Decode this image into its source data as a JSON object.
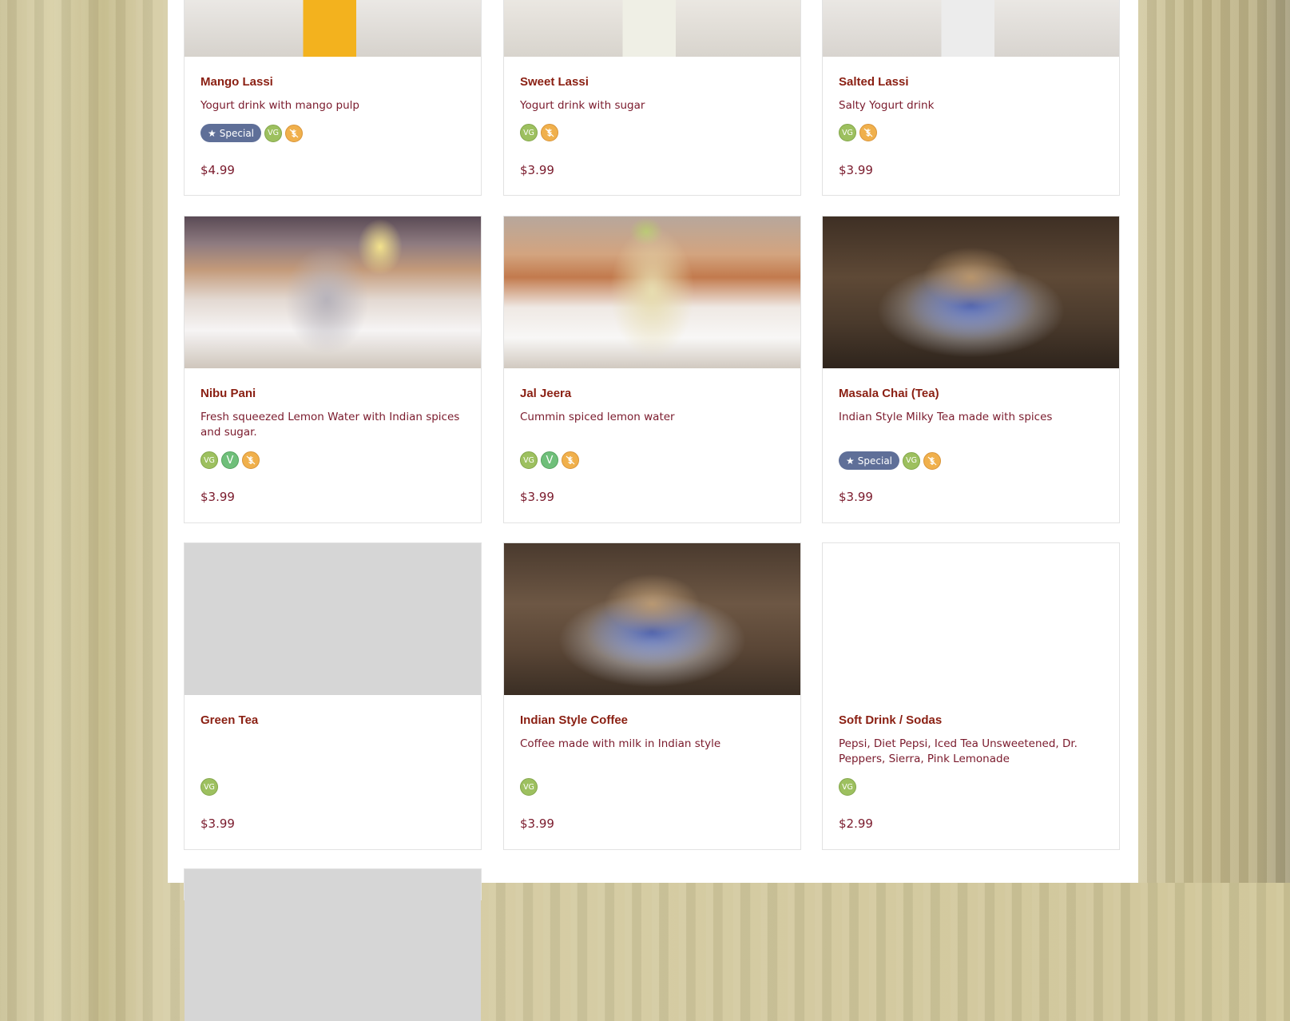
{
  "colors": {
    "title": "#8a1f12",
    "text": "#7a1a2c",
    "special_badge": "#5f6f98",
    "vg_icon": "#9dc05f",
    "v_icon": "#6fbf7a",
    "gf_icon": "#f0b04c"
  },
  "special_label": "Special",
  "icon_labels": {
    "vg": "VG",
    "v": "V"
  },
  "items": [
    {
      "title": "Mango Lassi",
      "desc": "Yogurt drink with mango pulp",
      "price": "$4.99",
      "special": true,
      "icons": [
        "vg",
        "gf"
      ]
    },
    {
      "title": "Sweet Lassi",
      "desc": "Yogurt drink with sugar",
      "price": "$3.99",
      "special": false,
      "icons": [
        "vg",
        "gf"
      ]
    },
    {
      "title": "Salted Lassi",
      "desc": "Salty Yogurt drink",
      "price": "$3.99",
      "special": false,
      "icons": [
        "vg",
        "gf"
      ]
    },
    {
      "title": "Nibu Pani",
      "desc": "Fresh squeezed Lemon Water with Indian spices and sugar.",
      "price": "$3.99",
      "special": false,
      "icons": [
        "vg",
        "v",
        "gf"
      ]
    },
    {
      "title": "Jal Jeera",
      "desc": "Cummin spiced lemon water",
      "price": "$3.99",
      "special": false,
      "icons": [
        "vg",
        "v",
        "gf"
      ]
    },
    {
      "title": "Masala Chai (Tea)",
      "desc": "Indian Style Milky Tea made with spices",
      "price": "$3.99",
      "special": true,
      "icons": [
        "vg",
        "gf"
      ]
    },
    {
      "title": "Green Tea",
      "desc": "",
      "price": "$3.99",
      "special": false,
      "icons": [
        "vg"
      ]
    },
    {
      "title": "Indian Style Coffee",
      "desc": "Coffee made with milk in Indian style",
      "price": "$3.99",
      "special": false,
      "icons": [
        "vg"
      ]
    },
    {
      "title": "Soft Drink / Sodas",
      "desc": "Pepsi, Diet Pepsi, Iced Tea Unsweetened, Dr. Peppers, Sierra, Pink Lemonade",
      "price": "$2.99",
      "special": false,
      "icons": [
        "vg"
      ]
    }
  ]
}
